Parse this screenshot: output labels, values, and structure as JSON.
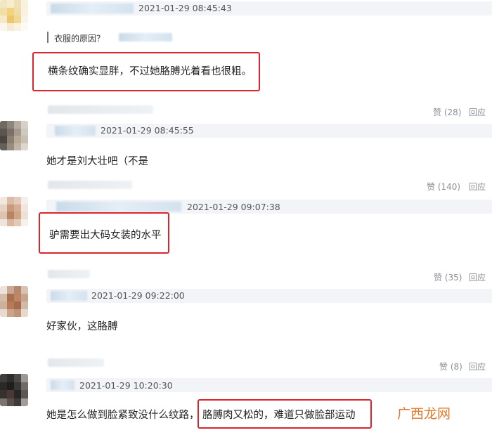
{
  "comments": [
    {
      "timestamp": "2021-01-29 08:45:43",
      "quote_text": "衣服的原因？",
      "text": "横条纹确实显胖，不过她胳膊光着看也很粗。"
    },
    {
      "likes_label": "赞 (28)",
      "reply_label": "回应",
      "timestamp": "2021-01-29 08:45:55",
      "text": "她才是刘大壮吧（不是"
    },
    {
      "likes_label": "赞 (140)",
      "reply_label": "回应",
      "timestamp": "2021-01-29 09:07:38",
      "text": "驴需要出大码女装的水平"
    },
    {
      "likes_label": "赞 (35)",
      "reply_label": "回应",
      "timestamp": "2021-01-29 09:22:00",
      "text": "好家伙，这胳膊"
    },
    {
      "likes_label": "赞 (8)",
      "reply_label": "回应",
      "timestamp": "2021-01-29 10:20:30",
      "text_prefix": "她是怎么做到脸紧致没什么纹路，",
      "text_highlight": "胳膊肉又松的，难道只做脸部运动"
    }
  ],
  "watermark": {
    "text": "广西龙网",
    "color": "#e07a2a"
  }
}
